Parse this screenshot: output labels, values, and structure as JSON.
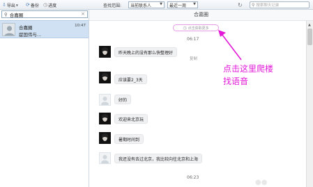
{
  "toolbar": {
    "export": "导出",
    "backup": "备份",
    "progress": "进度",
    "range_label": "查找范围:",
    "scope_value": "当前联系人",
    "period_value": "最近一周",
    "search_placeholder": "搜索聊天记录"
  },
  "sidebar": {
    "search_value": "合嘉圈",
    "clear_symbol": "×",
    "contact": {
      "name": "合嘉圈",
      "last_message": "龊国伟与...",
      "time": "10:47"
    }
  },
  "chat": {
    "title": "合嘉圈",
    "history_link": "点击获取更多",
    "messages": [
      {
        "time": "06:17"
      },
      {
        "text": "昨天晚上的没有那么快整理好",
        "copy": "复制",
        "avatar": "dark"
      },
      {
        "text": "应该要2_3天",
        "avatar": "dark"
      },
      {
        "text": "好的",
        "avatar": "light"
      },
      {
        "text": "欢迎来北京玩",
        "avatar": "dark"
      },
      {
        "text": "暑期时间到",
        "avatar": "dark"
      },
      {
        "text": "我还没有去过北京，我比较向往北京和上海",
        "avatar": "light"
      },
      {
        "time": "06:23"
      }
    ]
  },
  "annotation": {
    "line1": "点击这里爬楼",
    "line2": "找语音",
    "color": "#e21ad8"
  },
  "colors": {
    "accent": "#cfe1f3",
    "annotation": "#e21ad8"
  }
}
